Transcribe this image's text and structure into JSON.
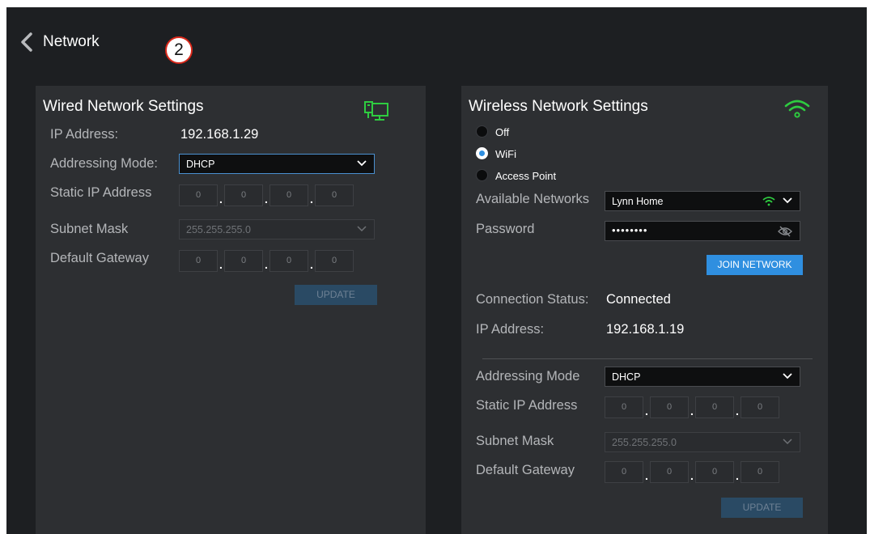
{
  "header": {
    "title": "Network",
    "step_badge": "2"
  },
  "wired": {
    "title": "Wired Network Settings",
    "icon": "ethernet-icon",
    "ip_label": "IP Address:",
    "ip_value": "192.168.1.29",
    "mode_label": "Addressing Mode:",
    "mode_value": "DHCP",
    "static_label": "Static IP Address",
    "static_octets": [
      "0",
      "0",
      "0",
      "0"
    ],
    "subnet_label": "Subnet Mask",
    "subnet_value": "255.255.255.0",
    "gateway_label": "Default Gateway",
    "gateway_octets": [
      "0",
      "0",
      "0",
      "0"
    ],
    "update_label": "UPDATE"
  },
  "wireless": {
    "title": "Wireless Network Settings",
    "icon": "wifi-icon",
    "options": [
      {
        "label": "Off",
        "selected": false
      },
      {
        "label": "WiFi",
        "selected": true
      },
      {
        "label": "Access Point",
        "selected": false
      }
    ],
    "networks_label": "Available Networks",
    "network_value": "Lynn Home",
    "password_label": "Password",
    "password_value": "••••••••",
    "join_label": "JOIN NETWORK",
    "status_label": "Connection Status:",
    "status_value": "Connected",
    "ip_label": "IP Address:",
    "ip_value": "192.168.1.19",
    "mode_label": "Addressing Mode",
    "mode_value": "DHCP",
    "static_label": "Static IP Address",
    "static_octets": [
      "0",
      "0",
      "0",
      "0"
    ],
    "subnet_label": "Subnet Mask",
    "subnet_value": "255.255.255.0",
    "gateway_label": "Default Gateway",
    "gateway_octets": [
      "0",
      "0",
      "0",
      "0"
    ],
    "update_label": "UPDATE"
  },
  "colors": {
    "accent": "#2f8fe0",
    "status_green": "#2ecc40",
    "panel": "#2d2f32",
    "background": "#1d1f22"
  }
}
